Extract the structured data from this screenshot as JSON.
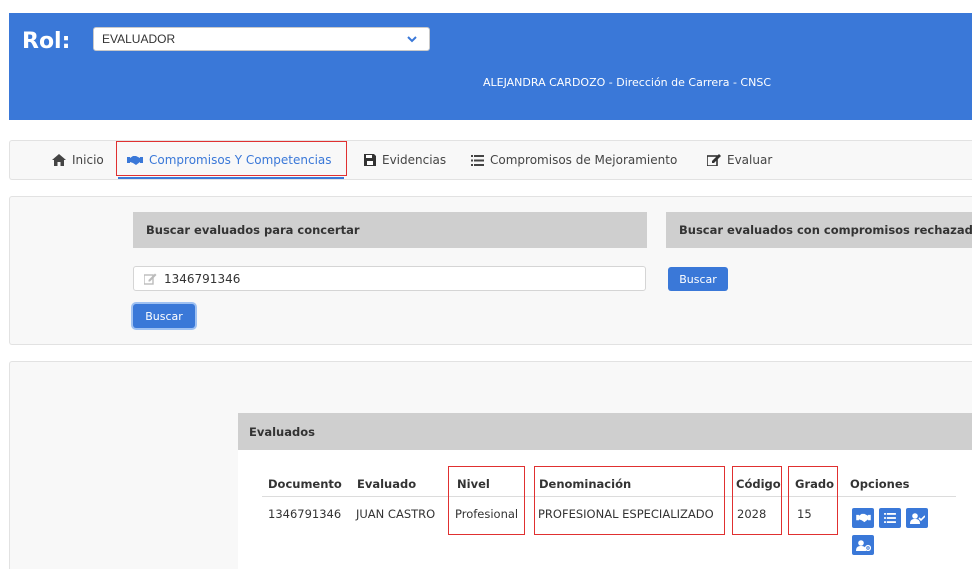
{
  "header": {
    "rol_label": "Rol:",
    "rol_selected": "EVALUADOR",
    "user_line": "ALEJANDRA CARDOZO - Dirección de Carrera - CNSC"
  },
  "nav": {
    "items": [
      {
        "label": "Inicio",
        "icon": "home-icon"
      },
      {
        "label": "Compromisos Y Competencias",
        "icon": "handshake-icon",
        "active": true
      },
      {
        "label": "Evidencias",
        "icon": "save-icon"
      },
      {
        "label": "Compromisos de Mejoramiento",
        "icon": "list-icon"
      },
      {
        "label": "Evaluar",
        "icon": "edit-icon"
      }
    ]
  },
  "search": {
    "left_title": "Buscar evaluados para concertar",
    "right_title": "Buscar evaluados con compromisos rechazados",
    "input_value": "1346791346",
    "left_button": "Buscar",
    "right_button": "Buscar"
  },
  "results": {
    "title": "Evaluados",
    "columns": [
      "Documento",
      "Evaluado",
      "Nivel",
      "Denominación",
      "Código",
      "Grado",
      "Opciones"
    ],
    "rows": [
      {
        "documento": "1346791346",
        "evaluado": "JUAN CASTRO",
        "nivel": "Profesional",
        "denominacion": "PROFESIONAL ESPECIALIZADO",
        "codigo": "2028",
        "grado": "15"
      }
    ],
    "option_icons": [
      "handshake-icon",
      "list-icon",
      "user-check-icon",
      "user-gear-icon"
    ]
  },
  "colors": {
    "primary": "#3a78d8",
    "highlight": "#e03030",
    "bar_gray": "#cfcfcf"
  }
}
